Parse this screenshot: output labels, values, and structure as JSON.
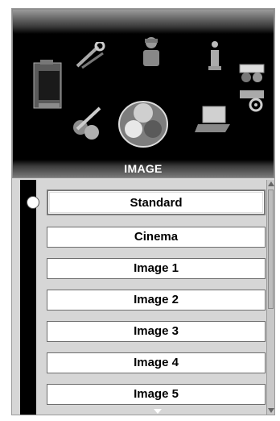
{
  "menu": {
    "title": "IMAGE",
    "icons": [
      "display-icon",
      "wrench-icon",
      "person-icon",
      "info-icon",
      "projector-icon",
      "screen-settings-icon",
      "laptop-icon",
      "image-spheres-icon",
      "color-adjust-icon"
    ]
  },
  "list": {
    "items": [
      {
        "label": "Standard",
        "selected": true
      },
      {
        "label": "Cinema"
      },
      {
        "label": "Image 1"
      },
      {
        "label": "Image 2"
      },
      {
        "label": "Image 3"
      },
      {
        "label": "Image 4"
      },
      {
        "label": "Image 5"
      }
    ]
  },
  "colors": {
    "panel_background": "#000000",
    "list_background": "#d6d6d6",
    "item_background": "#ffffff"
  }
}
